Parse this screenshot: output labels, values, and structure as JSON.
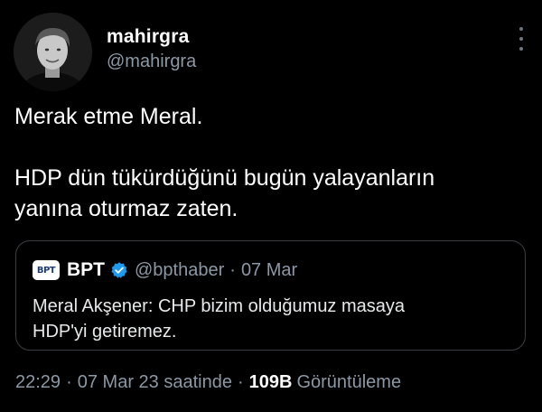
{
  "author": {
    "display_name": "mahirgra",
    "handle": "@mahirgra"
  },
  "tweet": {
    "line1": "Merak etme Meral.",
    "line2": "HDP dün tükürdüğünü bugün yalayanların",
    "line3": "yanına oturmaz zaten."
  },
  "quoted_tweet": {
    "avatar_text": "BPT",
    "display_name": "BPT",
    "verified": true,
    "handle": "@bpthaber",
    "separator": "·",
    "date": "07 Mar",
    "line1": "Meral Akşener: CHP bizim olduğumuz masaya",
    "line2": "HDP'yi getiremez."
  },
  "meta": {
    "time": "22:29",
    "separator": "·",
    "date": "07 Mar 23 saatinde",
    "views_count": "109B",
    "views_label": "Görüntüleme"
  },
  "icons": {
    "more": "more-vertical-icon",
    "verified": "verified-badge-icon"
  },
  "colors": {
    "background": "#000000",
    "text": "#ffffff",
    "secondary_text": "#8b98a5",
    "verified": "#1d9bf0",
    "border": "#3a3f44"
  }
}
